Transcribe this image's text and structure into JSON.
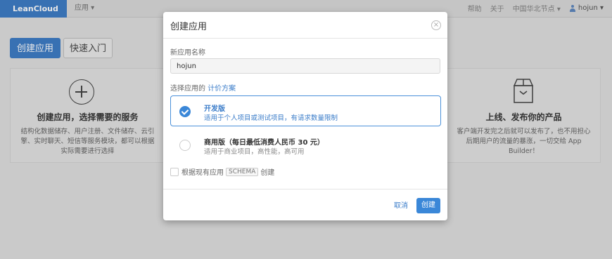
{
  "nav": {
    "brand": "LeanCloud",
    "apps_menu": "应用 ▾",
    "links": [
      "帮助",
      "关于",
      "中国华北节点 ▾"
    ],
    "user": "hojun ▾"
  },
  "page": {
    "create_app_button": "创建应用",
    "quickstart_button": "快速入门",
    "card_left": {
      "title": "创建应用，选择需要的服务",
      "desc": "结构化数据储存、用户注册、文件储存、云引擎、实时聊天、短信等服务模块，都可以根据实际需要进行选择"
    },
    "card_right": {
      "title": "上线、发布你的产品",
      "desc": "客户端开发完之后就可以发布了，也不用担心后期用户的流量的暴涨，一切交给 App Builder！"
    }
  },
  "modal": {
    "title": "创建应用",
    "name_label": "新应用名称",
    "name_value": "hojun",
    "plan_label": "选择应用的",
    "plan_link": "计价方案",
    "plans": [
      {
        "name": "开发版",
        "desc": "适用于个人项目或测试项目，有请求数量限制",
        "selected": true
      },
      {
        "name": "商用版（每日最低消费人民币 30 元）",
        "desc": "适用于商业项目，高性能，高可用",
        "selected": false
      }
    ],
    "schema_prefix": "根据现有应用",
    "schema_tag": "SCHEMA",
    "schema_suffix": "创建",
    "cancel": "取消",
    "create": "创建"
  },
  "colors": {
    "brand": "#2a6fc0",
    "accent": "#3a87d8",
    "link": "#3a7cc9"
  }
}
